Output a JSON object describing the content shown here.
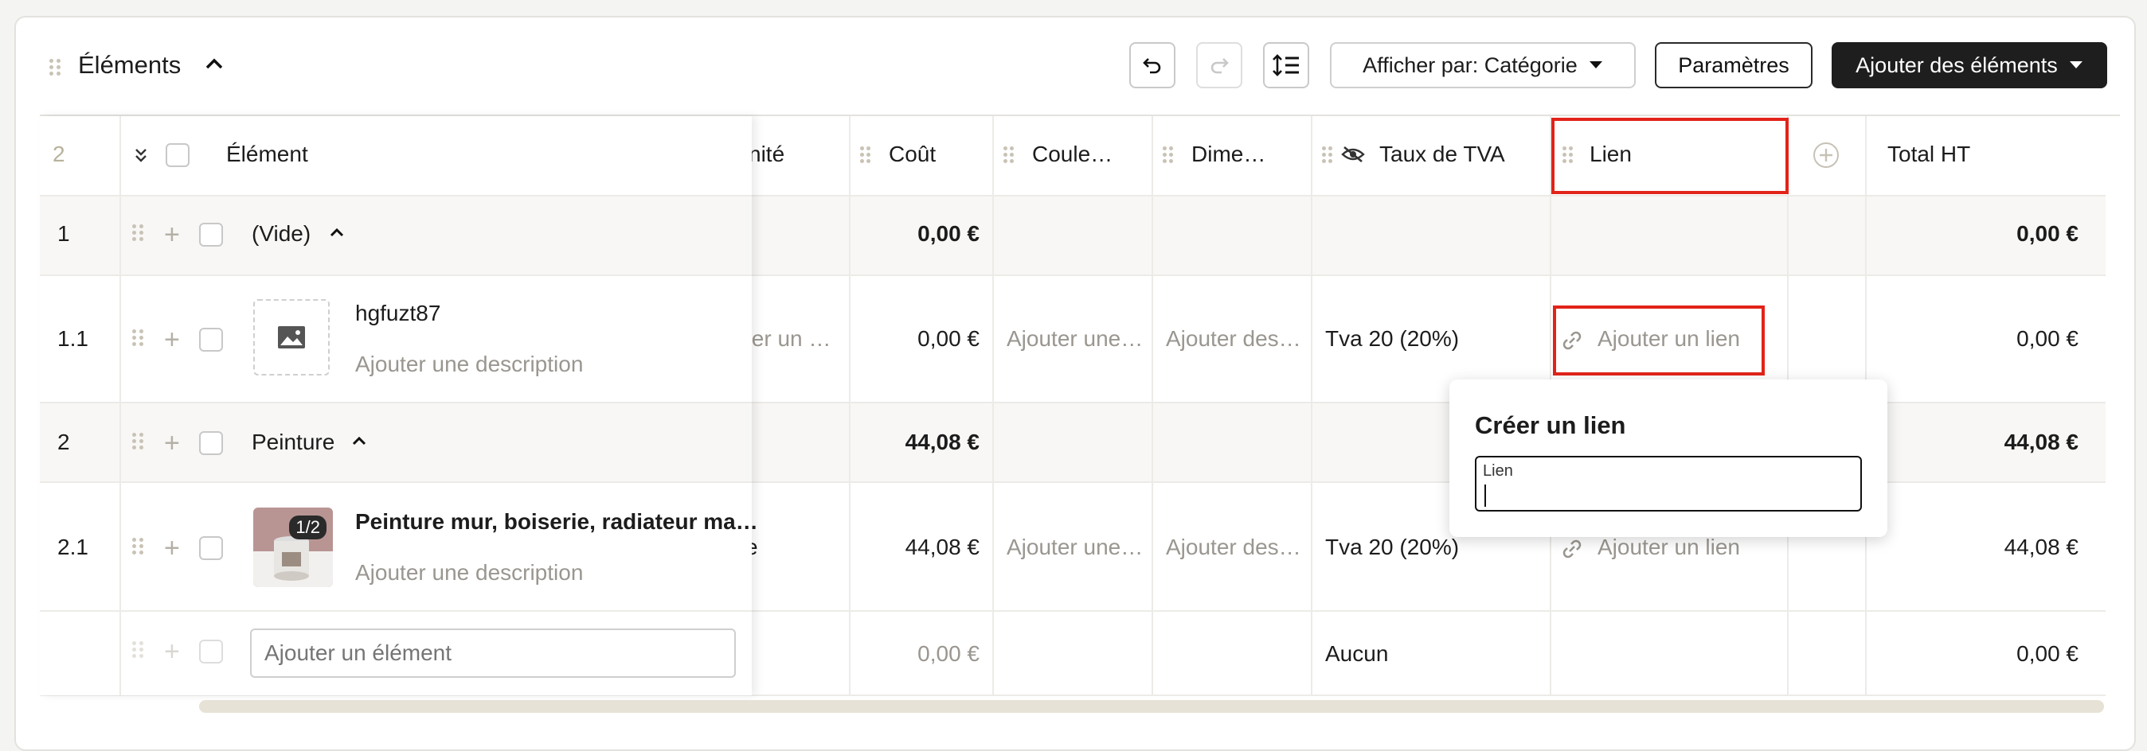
{
  "header": {
    "title": "Éléments",
    "group_by_label": "Afficher par: Catégorie",
    "settings_label": "Paramètres",
    "add_items_label": "Ajouter des éléments"
  },
  "columns": {
    "index": "2",
    "element": "Élément",
    "unite": "nité",
    "cout": "Coût",
    "couleur": "Coule…",
    "dimensions": "Dime…",
    "tva": "Taux de TVA",
    "lien": "Lien",
    "total": "Total HT"
  },
  "rows": [
    {
      "num": "1",
      "name": "(Vide)",
      "cost": "0,00 €",
      "total": "0,00 €"
    },
    {
      "num": "1.1",
      "name": "hgfuzt87",
      "desc": "Ajouter une description",
      "unit": "ter un …",
      "cost": "0,00 €",
      "color": "Ajouter une…",
      "dims": "Ajouter des…",
      "tva": "Tva 20 (20%)",
      "link": "Ajouter un lien",
      "total": "0,00 €"
    },
    {
      "num": "2",
      "name": "Peinture",
      "cost": "44,08 €",
      "total": "44,08 €"
    },
    {
      "num": "2.1",
      "name": "Peinture mur, boiserie, radiateur ma…",
      "desc": "Ajouter une description",
      "badge": "1/2",
      "unit": "e",
      "cost": "44,08 €",
      "color": "Ajouter une…",
      "dims": "Ajouter des…",
      "tva": "Tva 20 (20%)",
      "link": "Ajouter un lien",
      "total": "44,08 €"
    }
  ],
  "add_row": {
    "placeholder": "Ajouter un élément",
    "cost": "0,00 €",
    "tva": "Aucun",
    "total": "0,00 €"
  },
  "popover": {
    "title": "Créer un lien",
    "field_label": "Lien"
  },
  "colors": {
    "accent_red": "#e2231a",
    "dark": "#1e1e1e"
  }
}
